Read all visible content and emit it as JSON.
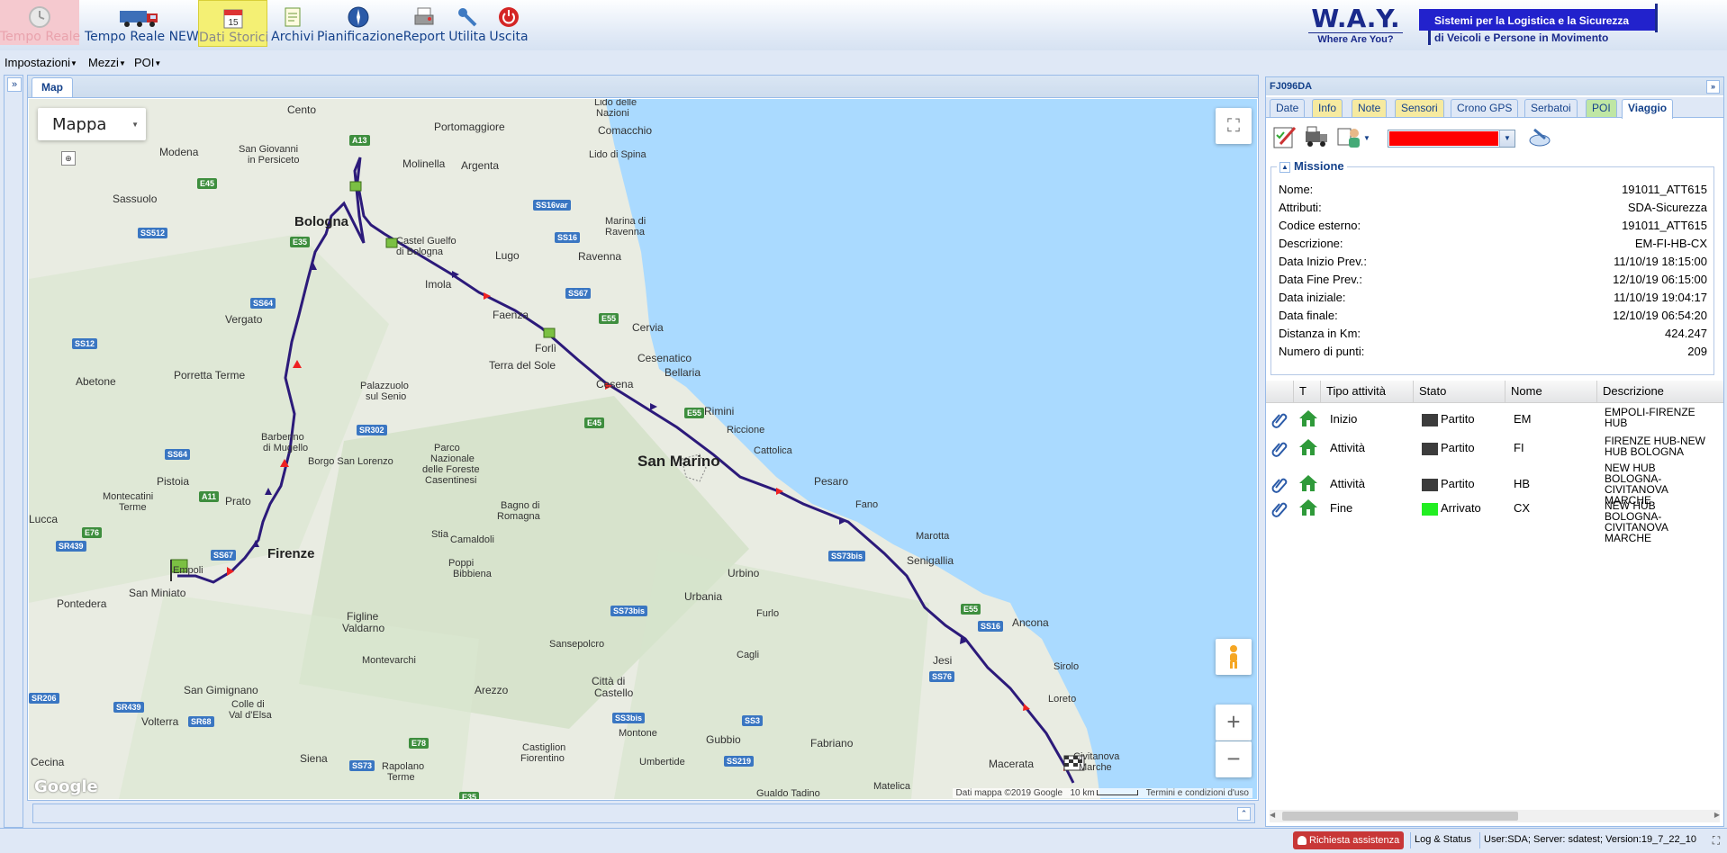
{
  "toolbar": {
    "buttons": [
      {
        "label": "Tempo Reale",
        "icon": "clock-icon"
      },
      {
        "label": "Tempo Reale NEW",
        "icon": "truck-icon"
      },
      {
        "label": "Dati Storici",
        "icon": "calendar-icon",
        "calendar_day": "15"
      },
      {
        "label": "Archivi",
        "icon": "notepad-icon"
      },
      {
        "label": "Pianificazione",
        "icon": "compass-icon"
      },
      {
        "label": "Report",
        "icon": "printer-icon"
      },
      {
        "label": "Utilita",
        "icon": "wrench-icon"
      },
      {
        "label": "Uscita",
        "icon": "power-icon"
      }
    ]
  },
  "logo": {
    "brand": "W.A.Y.",
    "tagline": "Where Are You?",
    "claim_line1": "Sistemi per la Logistica e la Sicurezza",
    "claim_line2": "di Veicoli e Persone in Movimento",
    "brand_color": "#1a2a8c"
  },
  "menubar": {
    "items": [
      "Impostazioni",
      "Mezzi",
      "POI"
    ]
  },
  "map_panel": {
    "tab": "Map",
    "map_type": "Mappa",
    "places": {
      "cento": "Cento",
      "portomaggiore": "Portomaggiore",
      "lido_nazioni": "Lido delle",
      "lido_nazioni2": "Nazioni",
      "comacchio": "Comacchio",
      "lido_spina": "Lido di Spina",
      "modena": "Modena",
      "san_giovanni": "San Giovanni",
      "persiceto": "in Persiceto",
      "molinella": "Molinella",
      "argenta": "Argenta",
      "sassuolo": "Sassuolo",
      "bologna": "Bologna",
      "marina_ravenna": "Marina di",
      "marina_ravenna2": "Ravenna",
      "castel_guelfo": "Castel Guelfo",
      "castel_guelfo2": "di Bologna",
      "lugo": "Lugo",
      "ravenna": "Ravenna",
      "imola": "Imola",
      "vergato": "Vergato",
      "faenza": "Faenza",
      "cervia": "Cervia",
      "forli": "Forlì",
      "cesenatico": "Cesenatico",
      "terra_sole": "Terra del Sole",
      "porretta": "Porretta Terme",
      "abetone": "Abetone",
      "palazzuolo": "Palazzuolo",
      "palazzuolo2": "sul Senio",
      "bellaria": "Bellaria",
      "cesena": "Cesena",
      "rimini": "Rimini",
      "riccione": "Riccione",
      "san_marino": "San Marino",
      "cattolica": "Cattolica",
      "barberino": "Barberino",
      "barberino2": "di Mugello",
      "borgo_lorenzo": "Borgo San Lorenzo",
      "parco1": "Parco",
      "parco2": "Nazionale",
      "parco3": "delle Foreste",
      "parco4": "Casentinesi",
      "pesaro": "Pesaro",
      "pistoia": "Pistoia",
      "montecatini": "Montecatini",
      "montecatini2": "Terme",
      "prato": "Prato",
      "fano": "Fano",
      "lucca": "Lucca",
      "bagno": "Bagno di",
      "bagno2": "Romagna",
      "marotta": "Marotta",
      "firenze": "Firenze",
      "stia": "Stia",
      "camaldoli": "Camaldoli",
      "senigallia": "Senigallia",
      "pontedera": "Pontedera",
      "san_miniato": "San Miniato",
      "empoli": "Empoli",
      "urbino": "Urbino",
      "poppi": "Poppi",
      "bibbiena": "Bibbiena",
      "urbania": "Urbania",
      "ancona": "Ancona",
      "figline": "Figline",
      "figline2": "Valdarno",
      "furlo": "Furlo",
      "sansepolcro": "Sansepolcro",
      "montevarchi": "Montevarchi",
      "cagli": "Cagli",
      "jesi": "Jesi",
      "sirolo": "Sirolo",
      "san_gimignano": "San Gimignano",
      "colle": "Colle di",
      "colle2": "Val d'Elsa",
      "arezzo": "Arezzo",
      "citta_castello": "Città di",
      "citta_castello2": "Castello",
      "loreto": "Loreto",
      "volterra": "Volterra",
      "montone": "Montone",
      "gubbio": "Gubbio",
      "fabriano": "Fabriano",
      "cecina": "Cecina",
      "siena": "Siena",
      "rapolano": "Rapolano",
      "rapolano2": "Terme",
      "castiglion": "Castiglion",
      "castiglion2": "Fiorentino",
      "umbertide": "Umbertide",
      "macerata": "Macerata",
      "civitanova": "Civitanova",
      "civitanova2": "Marche",
      "matelica": "Matelica",
      "gualdo": "Gualdo Tadino"
    },
    "shields": [
      "A13",
      "E45",
      "SS16var",
      "SS512",
      "SS16",
      "E35",
      "SS67",
      "E55",
      "SS64",
      "SS12",
      "SR302",
      "SS64",
      "E45",
      "E55",
      "A11",
      "E76",
      "SR439",
      "SS67",
      "SS73bis",
      "SS73bis",
      "E55",
      "SS16",
      "SS76",
      "SS3bis",
      "SS3",
      "SR206",
      "SR439",
      "SR68",
      "E78",
      "SS73",
      "SS219",
      "E35"
    ],
    "attribution": "Dati mappa ©2019 Google",
    "scale": "10 km",
    "terms": "Termini e condizioni d'uso",
    "google": "Google"
  },
  "right_panel": {
    "title": "FJ096DA",
    "tabs": [
      {
        "label": "Date",
        "style": "normal"
      },
      {
        "label": "Info",
        "style": "yellow"
      },
      {
        "label": "Note",
        "style": "yellow"
      },
      {
        "label": "Sensori",
        "style": "yellow"
      },
      {
        "label": "Crono GPS",
        "style": "normal"
      },
      {
        "label": "Serbatoi",
        "style": "normal"
      },
      {
        "label": "POI",
        "style": "green"
      },
      {
        "label": "Viaggio",
        "style": "active"
      }
    ],
    "vehicle_color": "#ff0000",
    "missione": {
      "legend": "Missione",
      "rows": [
        {
          "k": "Nome:",
          "v": "191011_ATT615"
        },
        {
          "k": "Attributi:",
          "v": "SDA-Sicurezza"
        },
        {
          "k": "Codice esterno:",
          "v": "191011_ATT615"
        },
        {
          "k": "Descrizione:",
          "v": "EM-FI-HB-CX"
        },
        {
          "k": "Data Inizio Prev.:",
          "v": "11/10/19 18:15:00"
        },
        {
          "k": "Data Fine Prev.:",
          "v": "12/10/19 06:15:00"
        },
        {
          "k": "Data iniziale:",
          "v": "11/10/19 19:04:17"
        },
        {
          "k": "Data finale:",
          "v": "12/10/19 06:54:20"
        },
        {
          "k": "Distanza in Km:",
          "v": "424.247"
        },
        {
          "k": "Numero di punti:",
          "v": "209"
        }
      ]
    },
    "grid": {
      "headers": [
        "T",
        "Tipo attività",
        "Stato",
        "Nome",
        "Descrizione"
      ],
      "rows": [
        {
          "tipo": "Inizio",
          "stato": "Partito",
          "stato_color": "#3c3c3c",
          "nome": "EM",
          "desc": [
            "EMPOLI-FIRENZE",
            "HUB"
          ]
        },
        {
          "tipo": "Attività",
          "stato": "Partito",
          "stato_color": "#3c3c3c",
          "nome": "FI",
          "desc": [
            "FIRENZE HUB-NEW",
            "HUB BOLOGNA"
          ]
        },
        {
          "tipo": "Attività",
          "stato": "Partito",
          "stato_color": "#3c3c3c",
          "nome": "HB",
          "desc": [
            "NEW HUB",
            "BOLOGNA-",
            "CIVITANOVA",
            "MARCHE"
          ]
        },
        {
          "tipo": "Fine",
          "stato": "Arrivato",
          "stato_color": "#22ee22",
          "nome": "CX",
          "desc": [
            "NEW HUB",
            "BOLOGNA-",
            "CIVITANOVA",
            "MARCHE"
          ]
        }
      ]
    }
  },
  "status_bar": {
    "assist": "Richiesta assistenza",
    "log_status": "Log & Status",
    "info": "User:SDA; Server: sdatest; Version:19_7_22_10"
  }
}
